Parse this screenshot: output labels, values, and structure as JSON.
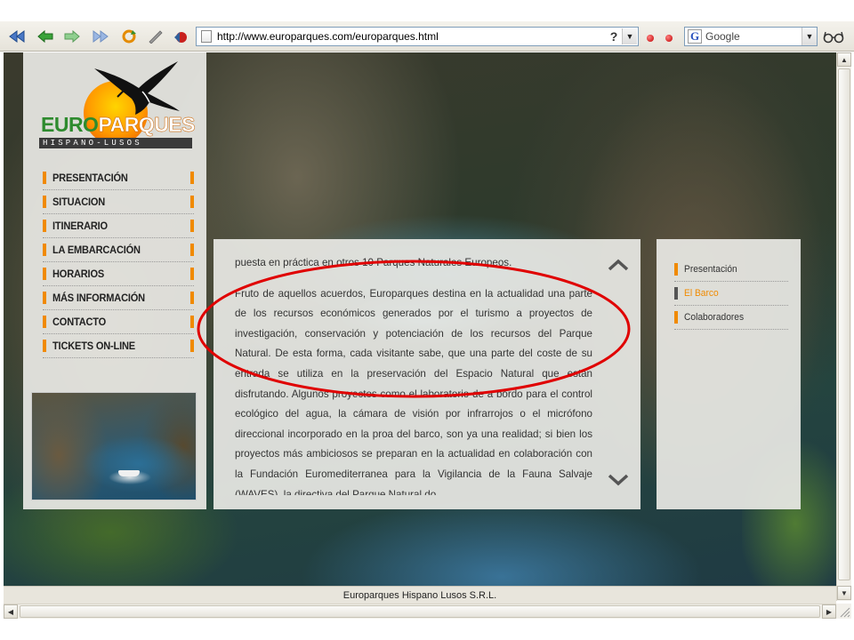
{
  "browser": {
    "url": "http://www.europarques.com/europarques.html",
    "help_label": "?",
    "search_engine": "Google"
  },
  "site": {
    "logo_word_a": "EURO",
    "logo_word_b": "PARQUES",
    "logo_sub": "HISPANO-LUSOS",
    "menu": [
      {
        "label": "PRESENTACIÓN"
      },
      {
        "label": "SITUACION"
      },
      {
        "label": "ITINERARIO"
      },
      {
        "label": "LA EMBARCACIÓN"
      },
      {
        "label": "HORARIOS"
      },
      {
        "label": "MÁS INFORMACIÓN"
      },
      {
        "label": "CONTACTO"
      },
      {
        "label": "TICKETS ON-LINE"
      }
    ],
    "content": {
      "paragraph_1": "puesta en práctica en otros 10 Parques Naturales Europeos.",
      "paragraph_2": "Fruto de aquellos acuerdos, Europarques destina en la actualidad una parte de los recursos económicos generados por el turismo a proyectos de investigación, conservación y potenciación de los recursos del Parque Natural. De esta forma, cada visitante sabe, que una parte del coste de su entrada se utiliza en la preservación del Espacio Natural que están disfrutando. Algunos proyectos como el laboratorio de a bordo para el control ecológico del agua, la cámara de visión por infrarrojos o el micrófono direccional incorporado en la proa del barco, son ya una realidad; si bien los proyectos más ambiciosos se preparan en la actualidad en colaboración con la Fundación Euromediterranea para la Vigilancia de la Fauna Salvaje (WAVES), la directiva del Parque Natural do"
    },
    "submenu": [
      {
        "label": "Presentación",
        "color": "#333333",
        "bar": "#f08a00"
      },
      {
        "label": "El Barco",
        "color": "#f08a00",
        "bar": "#555555"
      },
      {
        "label": "Colaboradores",
        "color": "#333333",
        "bar": "#f08a00"
      }
    ]
  },
  "statusbar": {
    "text": "Europarques Hispano Lusos S.R.L."
  },
  "colors": {
    "accent": "#f08a00",
    "annotation": "#e00000"
  }
}
